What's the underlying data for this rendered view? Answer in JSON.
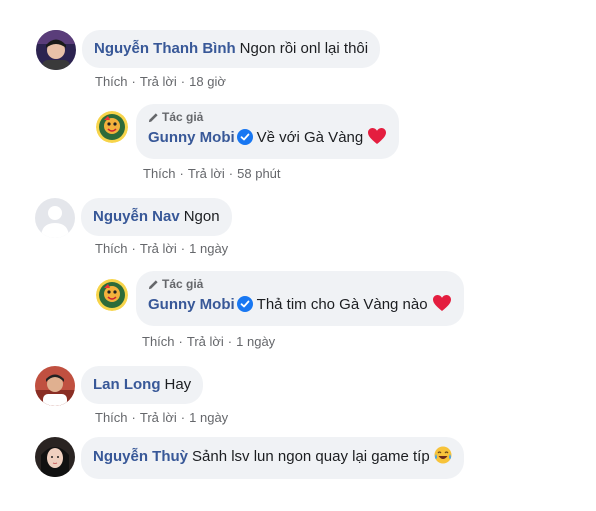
{
  "comments": [
    {
      "author": "Nguyễn Thanh Bình",
      "text": "Ngon rồi onl lại thôi",
      "like": "Thích",
      "reply": "Trả lời",
      "time": "18 giờ",
      "avatar_color": "#3a2f5a",
      "reply_item": {
        "role": "Tác giả",
        "author": "Gunny Mobi",
        "text": "Về với Gà Vàng",
        "like": "Thích",
        "reply": "Trả lời",
        "time": "58 phút",
        "emoji": "heart-icon"
      }
    },
    {
      "author": "Nguyễn Nav",
      "text": "Ngon",
      "like": "Thích",
      "reply": "Trả lời",
      "time": "1 ngày",
      "avatar_color": "#d8dadf",
      "reply_item": {
        "role": "Tác giả",
        "author": "Gunny Mobi",
        "text": "Thả tim cho Gà Vàng nào",
        "like": "Thích",
        "reply": "Trả lời",
        "time": "1 ngày",
        "emoji": "heart-icon"
      }
    },
    {
      "author": "Lan Long",
      "text": "Hay",
      "like": "Thích",
      "reply": "Trả lời",
      "time": "1 ngày",
      "avatar_color": "#b34a3a"
    },
    {
      "author": "Nguyễn Thuỳ",
      "text": "Sảnh lsv lun ngon quay lại game típ",
      "emoji": "laughing-tears-icon",
      "avatar_color": "#2a2422"
    }
  ],
  "colors": {
    "author": "#385898",
    "bubble": "#f0f2f5",
    "meta": "#65676b",
    "verified": "#1877f2",
    "heart": "#e41e3f"
  }
}
